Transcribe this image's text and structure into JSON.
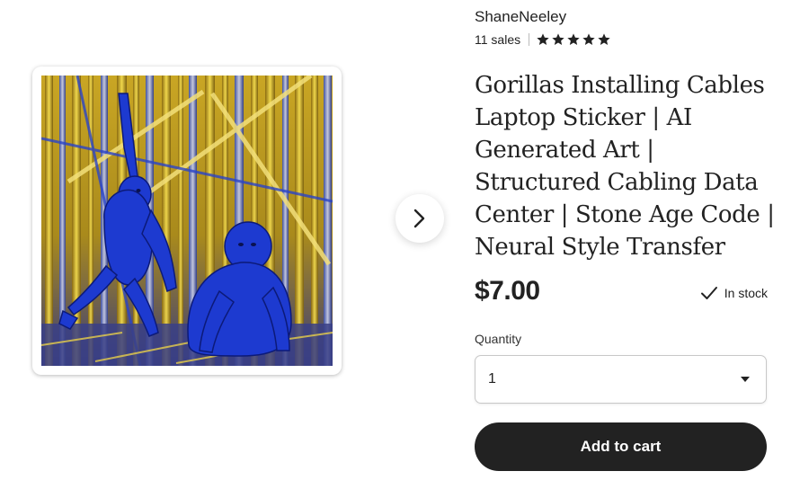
{
  "shop": {
    "name": "ShaneNeeley",
    "sales": "11 sales",
    "rating_stars": 5
  },
  "listing": {
    "title_lines": [
      "Gorillas Installing Cables",
      "Laptop Sticker | AI",
      "Generated Art |",
      "Structured Cabling Data",
      "Center | Stone Age Code |",
      "Neural Style Transfer"
    ],
    "price": "$7.00",
    "stock_status": "In stock"
  },
  "quantity": {
    "label": "Quantity",
    "value": "1"
  },
  "actions": {
    "add_to_cart": "Add to cart"
  },
  "icons": {
    "next": "chevron-right-icon",
    "check": "check-icon",
    "dropdown": "caret-down-icon",
    "star": "star-icon"
  },
  "colors": {
    "button_bg": "#222222",
    "button_text": "#ffffff",
    "text": "#222222",
    "art_blue": "#1f3fd4",
    "art_gold": "#d8b41c"
  }
}
